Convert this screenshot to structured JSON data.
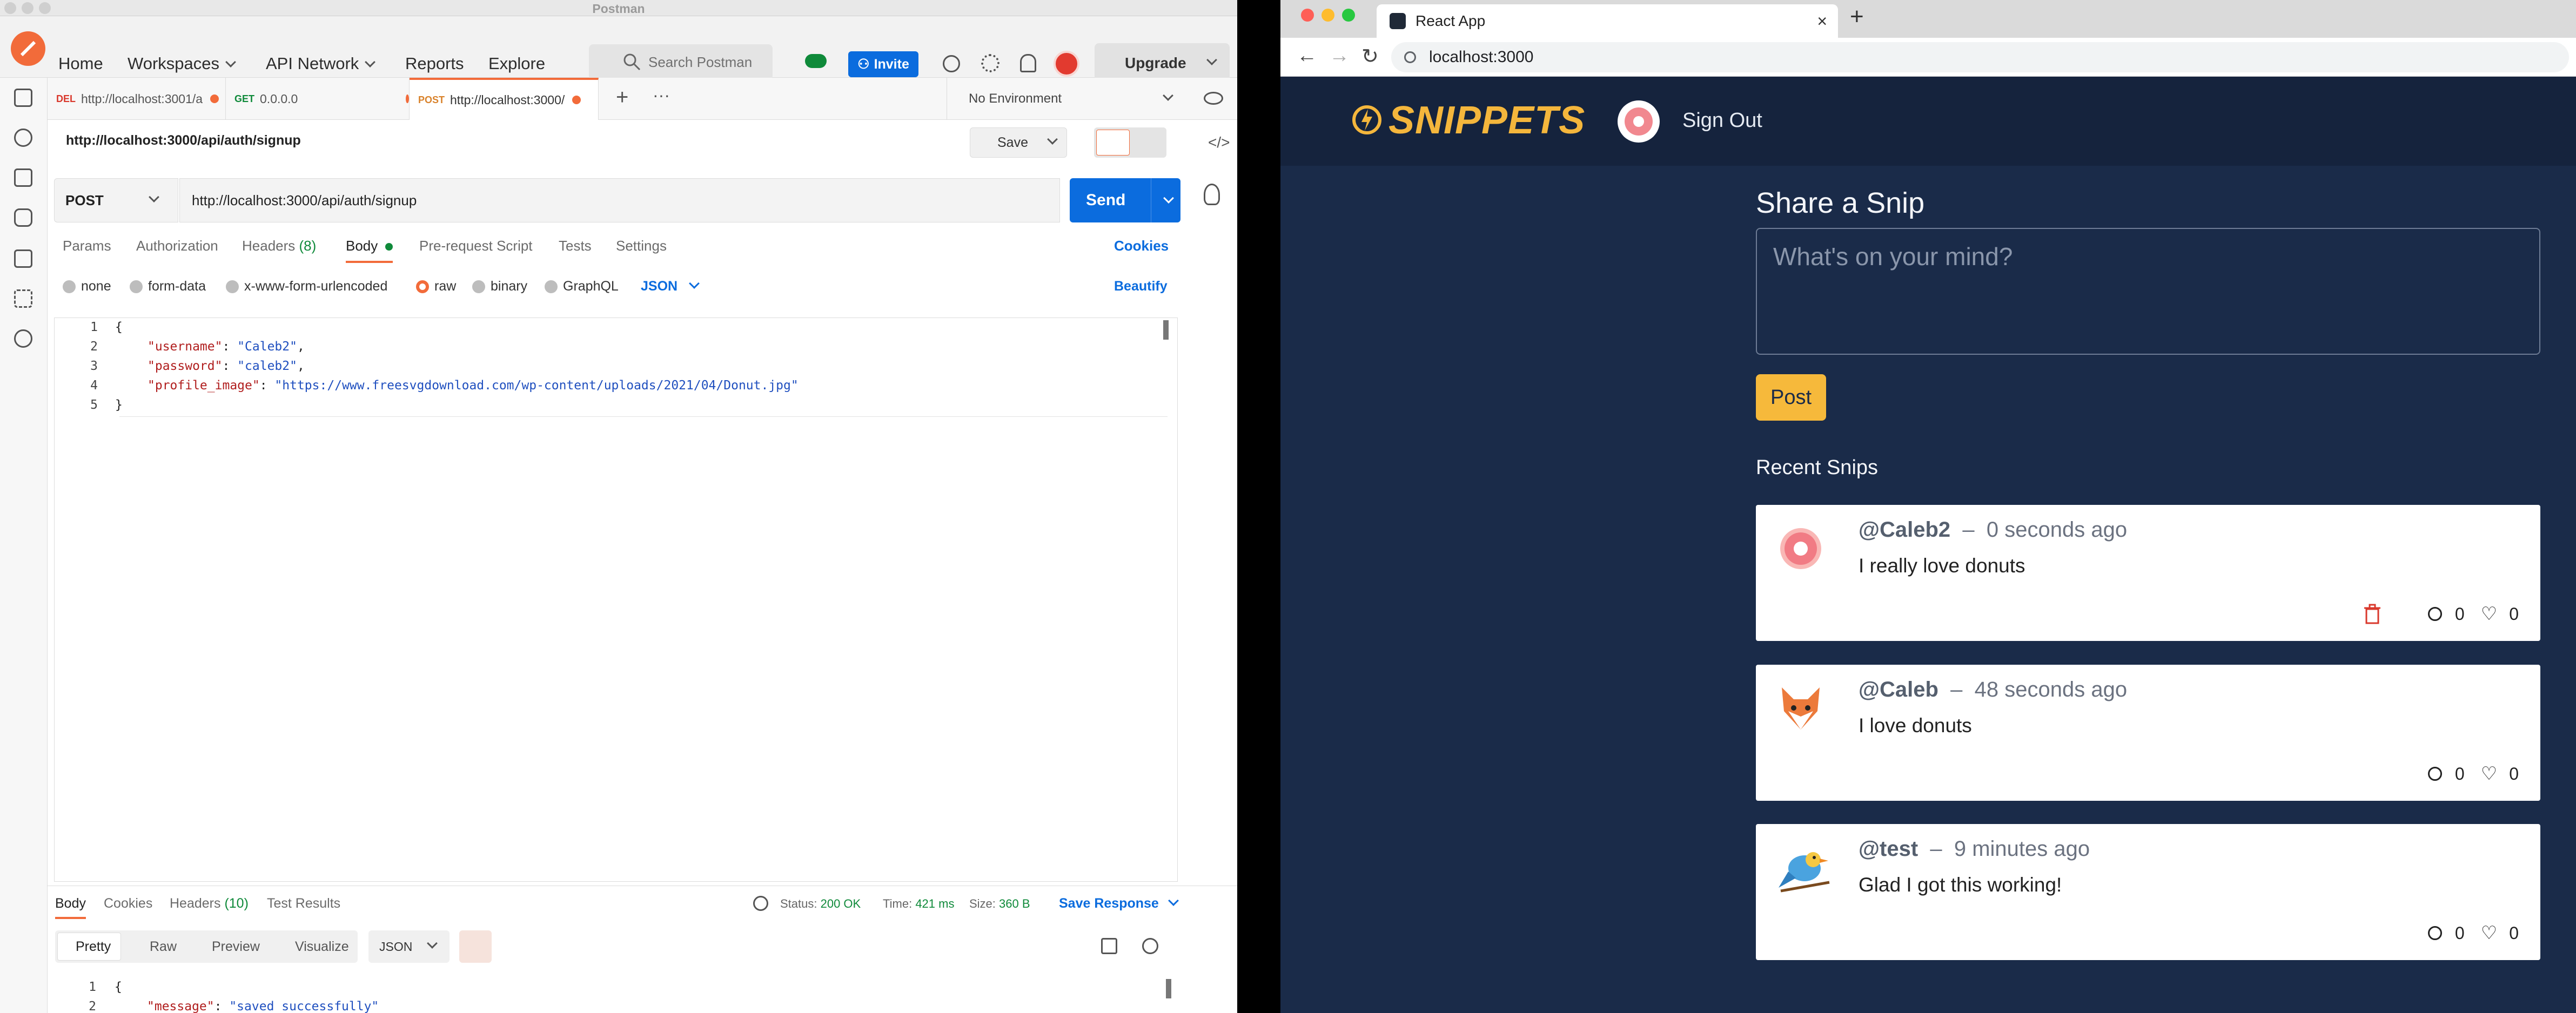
{
  "postman": {
    "window_title": "Postman",
    "nav": [
      "Home",
      "Workspaces",
      "API Network",
      "Reports",
      "Explore"
    ],
    "search_placeholder": "Search Postman",
    "invite": "Invite",
    "upgrade": "Upgrade",
    "tabs": [
      {
        "method": "DEL",
        "url": "http://localhost:3001/a",
        "method_color": "#d9382c"
      },
      {
        "method": "GET",
        "url": "0.0.0.0",
        "method_color": "#0f8a3a"
      },
      {
        "method": "POST",
        "url": "http://localhost:3000/",
        "method_color": "#d9822b"
      }
    ],
    "environment": "No Environment",
    "request_title": "http://localhost:3000/api/auth/signup",
    "save": "Save",
    "method": "POST",
    "url": "http://localhost:3000/api/auth/signup",
    "send": "Send",
    "req_tabs": [
      "Params",
      "Authorization",
      "Headers",
      "Body",
      "Pre-request Script",
      "Tests",
      "Settings"
    ],
    "headers_count": "(8)",
    "cookies": "Cookies",
    "body_types": [
      "none",
      "form-data",
      "x-www-form-urlencoded",
      "raw",
      "binary",
      "GraphQL"
    ],
    "format": "JSON",
    "beautify": "Beautify",
    "code": {
      "line_numbers": [
        "1",
        "2",
        "3",
        "4",
        "5"
      ],
      "open": "{",
      "k1": "\"username\"",
      "v1": "\"Caleb2\"",
      "k2": "\"password\"",
      "v2": "\"caleb2\"",
      "k3": "\"profile_image\"",
      "v3": "\"https://www.freesvgdownload.com/wp-content/uploads/2021/04/Donut.jpg\"",
      "close": "}"
    },
    "response": {
      "tabs": [
        "Body",
        "Cookies",
        "Headers",
        "Test Results"
      ],
      "headers_count": "(10)",
      "status_label": "Status:",
      "status": "200 OK",
      "time_label": "Time:",
      "time": "421 ms",
      "size_label": "Size:",
      "size": "360 B",
      "save_response": "Save Response",
      "views": [
        "Pretty",
        "Raw",
        "Preview",
        "Visualize"
      ],
      "format": "JSON",
      "line_numbers": [
        "1",
        "2"
      ],
      "open": "{",
      "key": "\"message\"",
      "value": "\"saved successfully\""
    }
  },
  "browser": {
    "tab_title": "React App",
    "address": "localhost:3000"
  },
  "site": {
    "logo": "SNIPPETS",
    "sign_out": "Sign Out",
    "share_title": "Share a Snip",
    "input_placeholder": "What's on your mind?",
    "post": "Post",
    "recent_title": "Recent Snips",
    "snips": [
      {
        "user": "@Caleb2",
        "time": "0 seconds ago",
        "text": "I really love donuts",
        "comments": "0",
        "likes": "0",
        "avatar": "donut-avatar",
        "deletable": true
      },
      {
        "user": "@Caleb",
        "time": "48 seconds ago",
        "text": "I love donuts",
        "comments": "0",
        "likes": "0",
        "avatar": "fox-avatar",
        "deletable": false
      },
      {
        "user": "@test",
        "time": "9 minutes ago",
        "text": "Glad I got this working!",
        "comments": "0",
        "likes": "0",
        "avatar": "bird-avatar",
        "deletable": false
      }
    ]
  }
}
